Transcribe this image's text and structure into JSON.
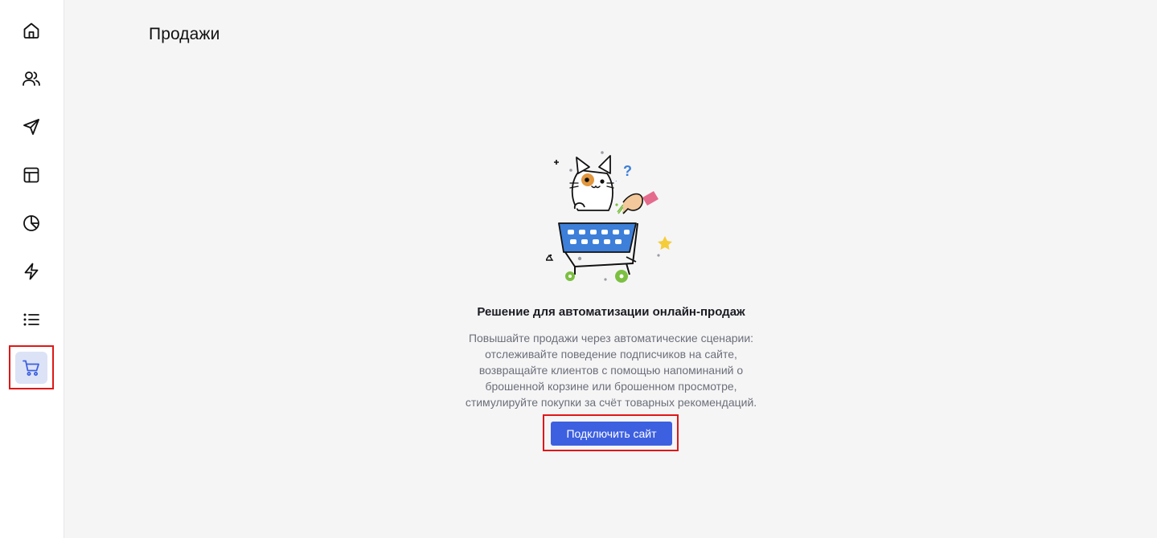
{
  "sidebar": {
    "items": [
      {
        "icon": "home-icon"
      },
      {
        "icon": "users-icon"
      },
      {
        "icon": "send-icon"
      },
      {
        "icon": "layout-icon"
      },
      {
        "icon": "pie-chart-icon"
      },
      {
        "icon": "lightning-icon"
      },
      {
        "icon": "list-icon"
      },
      {
        "icon": "cart-icon",
        "active": true
      }
    ],
    "active_color": "#3d60e0",
    "active_bg": "#dce3f6"
  },
  "header": {
    "title": "Продажи"
  },
  "empty_state": {
    "title": "Решение для автоматизации онлайн-продаж",
    "description": "Повышайте продажи через автоматические сценарии: отслеживайте поведение подписчиков на сайте, возвращайте клиентов с помощью напоминаний о брошенной корзине или брошенном просмотре, стимулируйте покупки за счёт товарных рекомендаций.",
    "button_label": "Подключить сайт",
    "illustration": "cat-in-shopping-cart",
    "illustration_tag": "%"
  },
  "colors": {
    "primary_button": "#3d60e0",
    "highlight_border": "#e01717",
    "background": "#f5f5f6"
  }
}
